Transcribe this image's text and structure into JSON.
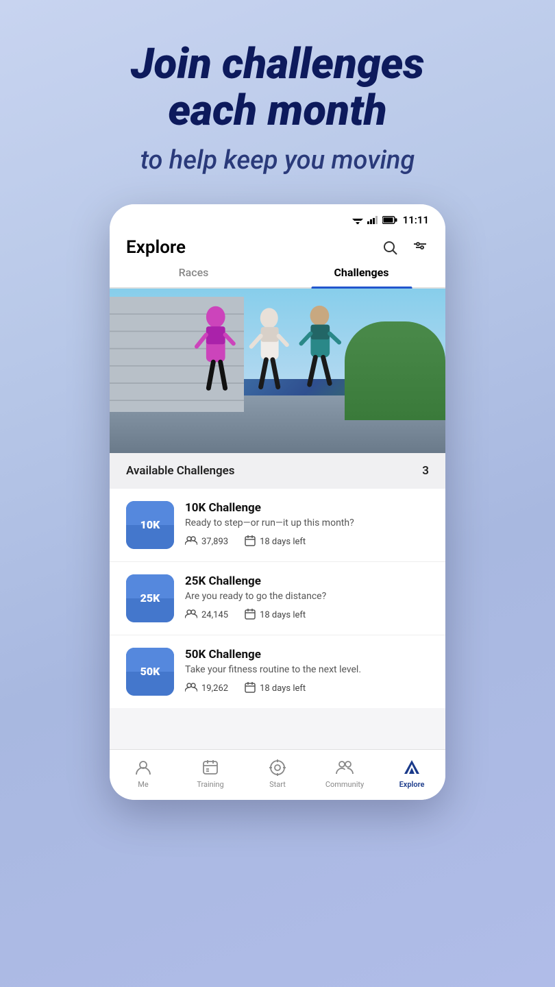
{
  "hero": {
    "title_line1": "Join challenges",
    "title_line2": "each month",
    "subtitle": "to help keep you moving"
  },
  "status_bar": {
    "time": "11:11"
  },
  "header": {
    "title": "Explore"
  },
  "tabs": [
    {
      "id": "races",
      "label": "Races",
      "active": false
    },
    {
      "id": "challenges",
      "label": "Challenges",
      "active": true
    }
  ],
  "available_challenges": {
    "label": "Available Challenges",
    "count": "3"
  },
  "challenges": [
    {
      "id": "10k",
      "name": "10K Challenge",
      "thumb_label": "10K",
      "description": "Ready to step—or run—it up this month?",
      "participants": "37,893",
      "days_left": "18 days left"
    },
    {
      "id": "25k",
      "name": "25K Challenge",
      "thumb_label": "25K",
      "description": "Are you ready to go the distance?",
      "participants": "24,145",
      "days_left": "18 days left"
    },
    {
      "id": "50k",
      "name": "50K Challenge",
      "thumb_label": "50K",
      "description": "Take your fitness routine to the next level.",
      "participants": "19,262",
      "days_left": "18 days left"
    }
  ],
  "bottom_nav": [
    {
      "id": "me",
      "label": "Me",
      "active": false
    },
    {
      "id": "training",
      "label": "Training",
      "active": false
    },
    {
      "id": "start",
      "label": "Start",
      "active": false
    },
    {
      "id": "community",
      "label": "Community",
      "active": false
    },
    {
      "id": "explore",
      "label": "Explore",
      "active": true
    }
  ]
}
